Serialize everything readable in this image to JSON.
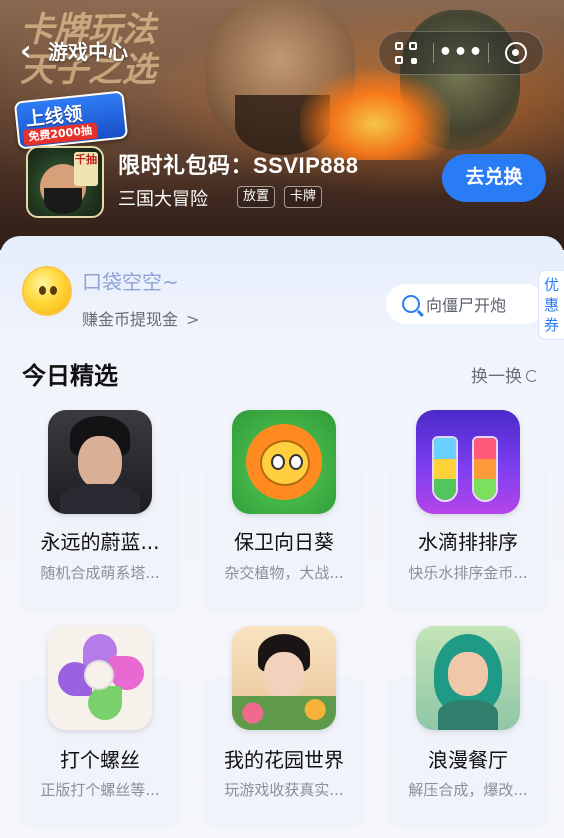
{
  "header": {
    "title": "游戏中心",
    "title_art": "卡牌玩法\n天子之选",
    "back_icon": "chevron-left-icon",
    "capsule": {
      "scan_icon": "qr-scan-icon",
      "more_icon": "more-dots-icon",
      "close_icon": "close-target-icon"
    }
  },
  "banner": {
    "promo_main": "上线领",
    "promo_sub": "免费2000抽",
    "icon_tag": "千抽",
    "gift_title": "限时礼包码：SSVIP888",
    "game_name": "三国大冒险",
    "tags": [
      "放置",
      "卡牌"
    ],
    "redeem_label": "去兑换"
  },
  "wallet": {
    "title": "口袋空空~",
    "subtitle": "赚金币提现金",
    "arrow": ">"
  },
  "search": {
    "placeholder": "向僵尸开炮"
  },
  "coupon_tab": "优惠券",
  "featured": {
    "title": "今日精选",
    "refresh_label": "换一换",
    "games": [
      {
        "name": "永远的蔚蓝...",
        "desc": "随机合成萌系塔..."
      },
      {
        "name": "保卫向日葵",
        "desc": "杂交植物，大战..."
      },
      {
        "name": "水滴排排序",
        "desc": "快乐水排序金币..."
      },
      {
        "name": "打个螺丝",
        "desc": "正版打个螺丝等..."
      },
      {
        "name": "我的花园世界",
        "desc": "玩游戏收获真实..."
      },
      {
        "name": "浪漫餐厅",
        "desc": "解压合成，爆改..."
      }
    ]
  },
  "colors": {
    "accent": "#2a7cf6",
    "banner_dark": "#2e1d17",
    "panel_bg": "#f1f4fb"
  }
}
